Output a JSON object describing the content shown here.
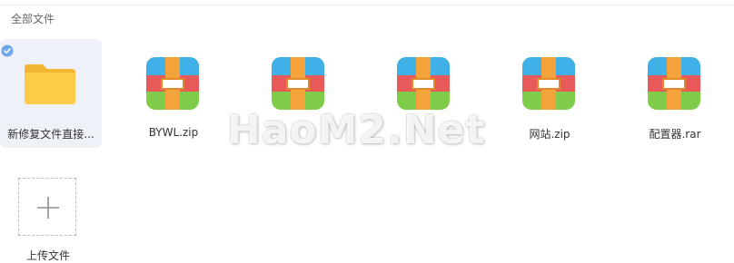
{
  "breadcrumb": {
    "label": "全部文件"
  },
  "files": [
    {
      "name": "新修复文件直接...",
      "type": "folder",
      "selected": true
    },
    {
      "name": "BYWL.zip",
      "type": "archive"
    },
    {
      "name": "",
      "type": "archive"
    },
    {
      "name": "",
      "type": "archive"
    },
    {
      "name": "网站.zip",
      "type": "archive"
    },
    {
      "name": "配置器.rar",
      "type": "archive"
    }
  ],
  "upload": {
    "label": "上传文件"
  },
  "watermark": {
    "text": "HaoM2.Net"
  },
  "colors": {
    "folder": "#f8c33d",
    "archive_top": "#3fb0e8",
    "archive_mid": "#e85a5a",
    "archive_bottom": "#7fcc4a",
    "archive_band": "#f4a33a"
  }
}
